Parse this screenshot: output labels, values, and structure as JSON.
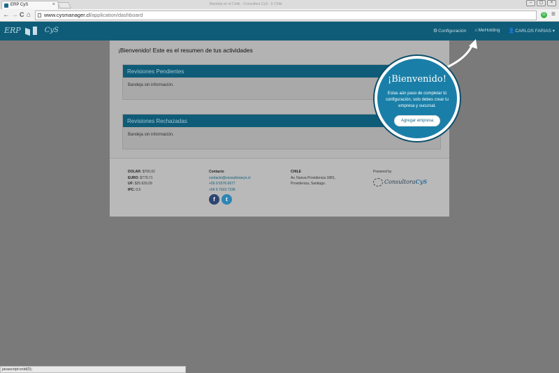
{
  "browser": {
    "tab_title": "ERP CyS",
    "tab_close": "×",
    "window_title": "Bandeja en el Cedir · Consultora CyS · Ir Chile",
    "window_buttons": [
      "–",
      "▢",
      "×"
    ],
    "url_domain": "www.cysmanager.cl",
    "url_path": "/application/dashboard",
    "back": "←",
    "forward": "→",
    "reload": "C",
    "home": "⌂",
    "extension_label": "G",
    "menu": "≡"
  },
  "header": {
    "logo_erp": "ERP",
    "logo_cys": "CyS",
    "nav": [
      {
        "icon": "⚙",
        "label": "Configuración"
      },
      {
        "icon": "⌂",
        "label": "MeHolding"
      },
      {
        "icon": "👤",
        "label": "CARLOS FARIAS ▾"
      }
    ]
  },
  "main": {
    "welcome_strong": "¡Bienvenido!",
    "welcome_rest": " Este es el resumen de tus actividades",
    "panels": [
      {
        "title": "Revisiones Pendientes",
        "body": "Bandeja sin información."
      },
      {
        "title": "Revisiones Rechazadas",
        "body": "Bandeja sin información."
      }
    ]
  },
  "footer": {
    "indicators": [
      {
        "label": "DOLAR:",
        "value": " $700,02"
      },
      {
        "label": "EURO:",
        "value": " $779,71"
      },
      {
        "label": "UF:",
        "value": " $25.629,09"
      },
      {
        "label": "IPC:",
        "value": " 0,5"
      }
    ],
    "contact_title": "Contacto",
    "contact_email": "contacto@consultoracys.cl",
    "contact_phone1": "+56 9 6576 6677",
    "contact_phone2": "+56 9 7623 7236",
    "facebook_glyph": "f",
    "twitter_glyph": "t",
    "address_title": "CHILE",
    "address_line1": "Av. Nueva Providencia 1881,",
    "address_line2": "Providencia, Santiago.",
    "powered_by": "Powered by",
    "brand_name": "Consultora",
    "brand_cys": "CyS"
  },
  "bubble": {
    "title": "¡Bienvenido!",
    "text": "Estas aún paso de completar tú configuración, solo debes crear tu empresa y sucursal.",
    "button": "Agregar empresa"
  },
  "status_bar": "javascript:void(0);"
}
